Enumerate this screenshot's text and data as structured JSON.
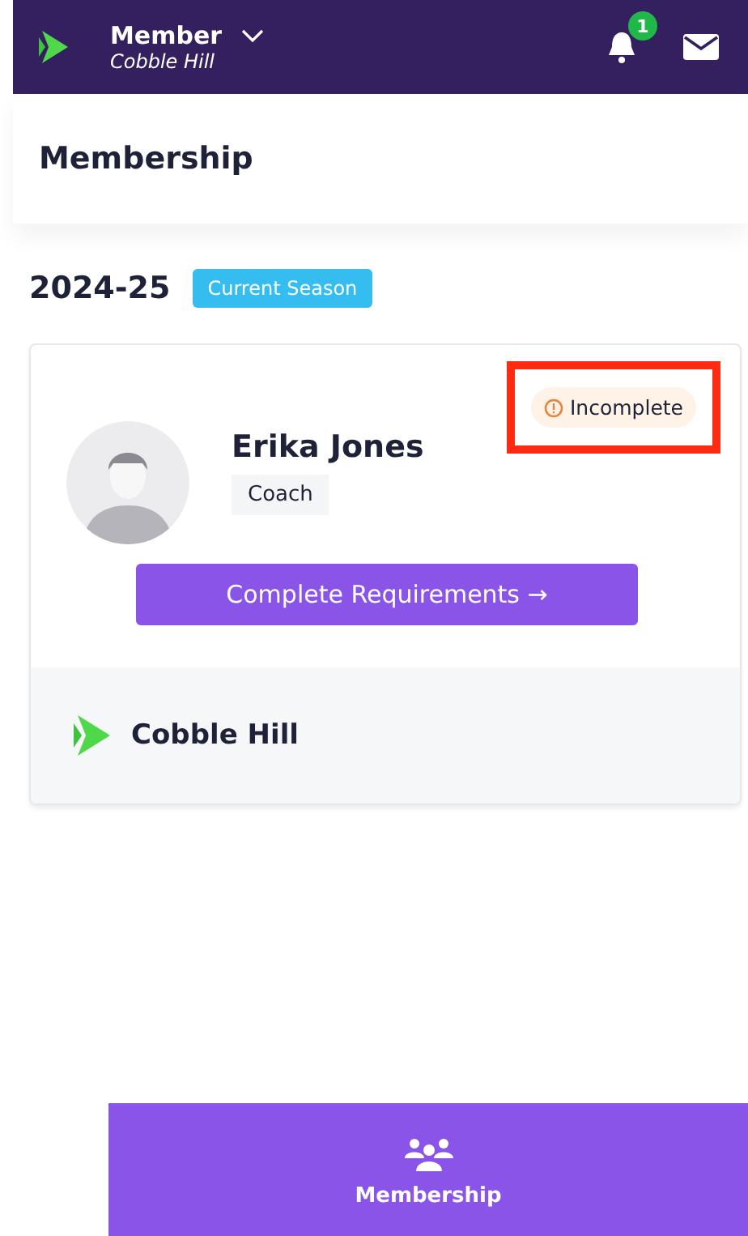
{
  "header": {
    "role": "Member",
    "club": "Cobble Hill",
    "notification_count": "1"
  },
  "page_title": "Membership",
  "season": {
    "label": "2024-25",
    "badge": "Current Season"
  },
  "membership_card": {
    "status": "Incomplete",
    "highlighted": true,
    "name": "Erika Jones",
    "role": "Coach",
    "action": "Complete Requirements →",
    "club": "Cobble Hill"
  },
  "bottom_nav": [
    {
      "label": "Membership",
      "selected": true
    }
  ]
}
